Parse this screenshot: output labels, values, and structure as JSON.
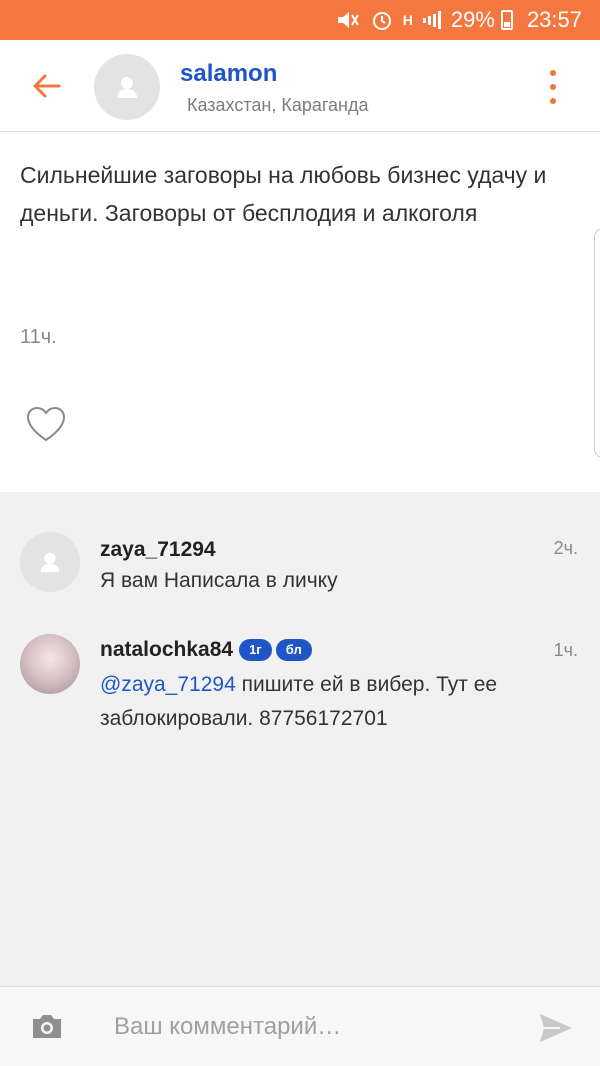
{
  "status_bar": {
    "battery": "29%",
    "time": "23:57",
    "network": "H"
  },
  "header": {
    "name": "salamon",
    "location": "Казахстан, Караганда"
  },
  "post": {
    "text": "Сильнейшие заговоры на любовь бизнес удачу и деньги. Заговоры от бесплодия и алкоголя",
    "time": "11ч."
  },
  "comments": [
    {
      "author": "zaya_71294",
      "time": "2ч.",
      "text": "Я вам Написала  в личку"
    },
    {
      "author": "natalochka84",
      "badges": [
        "1г",
        "бл"
      ],
      "time": "1ч.",
      "mention": "@zaya_71294",
      "text": " пишите ей в вибер. Тут ее заблокировали. 87756172701"
    }
  ],
  "composer": {
    "placeholder": "Ваш комментарий…"
  },
  "colors": {
    "accent": "#f3773f",
    "link": "#1f55c7"
  }
}
